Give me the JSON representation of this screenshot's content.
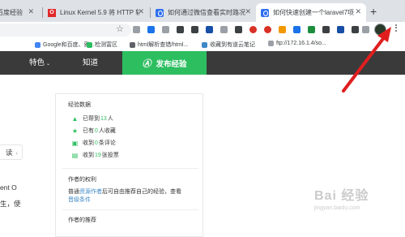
{
  "tabs": [
    {
      "title": "百度经验",
      "favicon": "baidu-paw-icon"
    },
    {
      "title": "Linux Kernel 5.9 将 HTTP 轨",
      "favicon": "oschina-icon"
    },
    {
      "title": "如何通过微信查看实时路况-百",
      "favicon": "baidu-paw-icon"
    },
    {
      "title": "如何快速创建一个laravel7项目",
      "favicon": "baidu-paw-icon",
      "active": true
    }
  ],
  "bookmarks": [
    {
      "label": "Google和百度、雅..."
    },
    {
      "label": "检测富区"
    },
    {
      "label": "html解析查错/html..."
    },
    {
      "label": "收藏到有道云笔记"
    },
    {
      "label": "ftp://172.16.1.4/so..."
    }
  ],
  "badges": {
    "extension_count": "14"
  },
  "nav": {
    "featured": "特色",
    "know": "知道",
    "publish": "发布经验"
  },
  "left_text": {
    "line1": "读",
    "line2": "ent O",
    "line3": "生，使"
  },
  "sidebar": {
    "stats_title": "经验数据",
    "stats": [
      {
        "pre": "已帮到",
        "num": "13",
        "post": "人",
        "icon": "thumbs-up-icon"
      },
      {
        "pre": "已有",
        "num": "0",
        "post": "人收藏",
        "icon": "star-icon"
      },
      {
        "pre": "收到",
        "num": "0",
        "post": "条评论",
        "icon": "comment-icon"
      },
      {
        "pre": "收到",
        "num": "19",
        "post": "张投票",
        "icon": "vote-icon"
      }
    ],
    "author_privilege_title": "作者的权利",
    "author_privilege_text_pre": "普通",
    "author_privilege_link": "资源作者",
    "author_privilege_text_post": "后可自由推荐自己的经验，查看",
    "upgrade_link": "晋级条件",
    "recommend_title": "作者的推荐"
  },
  "watermark": {
    "name": "Bai 经验",
    "sub": "jingyan.baidu.com"
  },
  "colors": {
    "accent_green": "#2dbe60",
    "nav_dark": "#3a3a3a",
    "link_blue": "#3f88c5",
    "arrow_red": "#e01e1e"
  }
}
